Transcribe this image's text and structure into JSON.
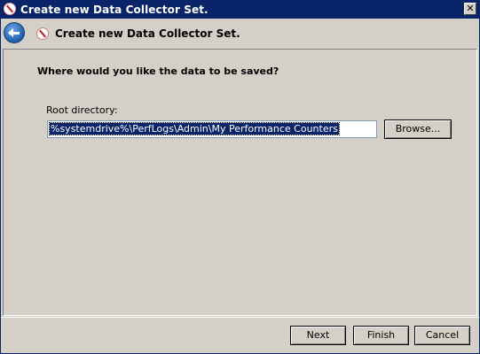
{
  "window": {
    "title": "Create new Data Collector Set.",
    "close_glyph": "✕"
  },
  "header": {
    "title": "Create new Data Collector Set.",
    "back_icon": "back-arrow-icon",
    "wizard_icon": "data-collector-icon"
  },
  "main": {
    "question": "Where would you like the data to be saved?",
    "root_label": "Root directory:",
    "root_value": "%systemdrive%\\PerfLogs\\Admin\\My Performance Counters",
    "browse_label": "Browse..."
  },
  "footer": {
    "next_label": "Next",
    "finish_label": "Finish",
    "cancel_label": "Cancel"
  },
  "colors": {
    "titlebar": "#0a246a",
    "face": "#d4d0c8",
    "selection": "#0a246a"
  }
}
